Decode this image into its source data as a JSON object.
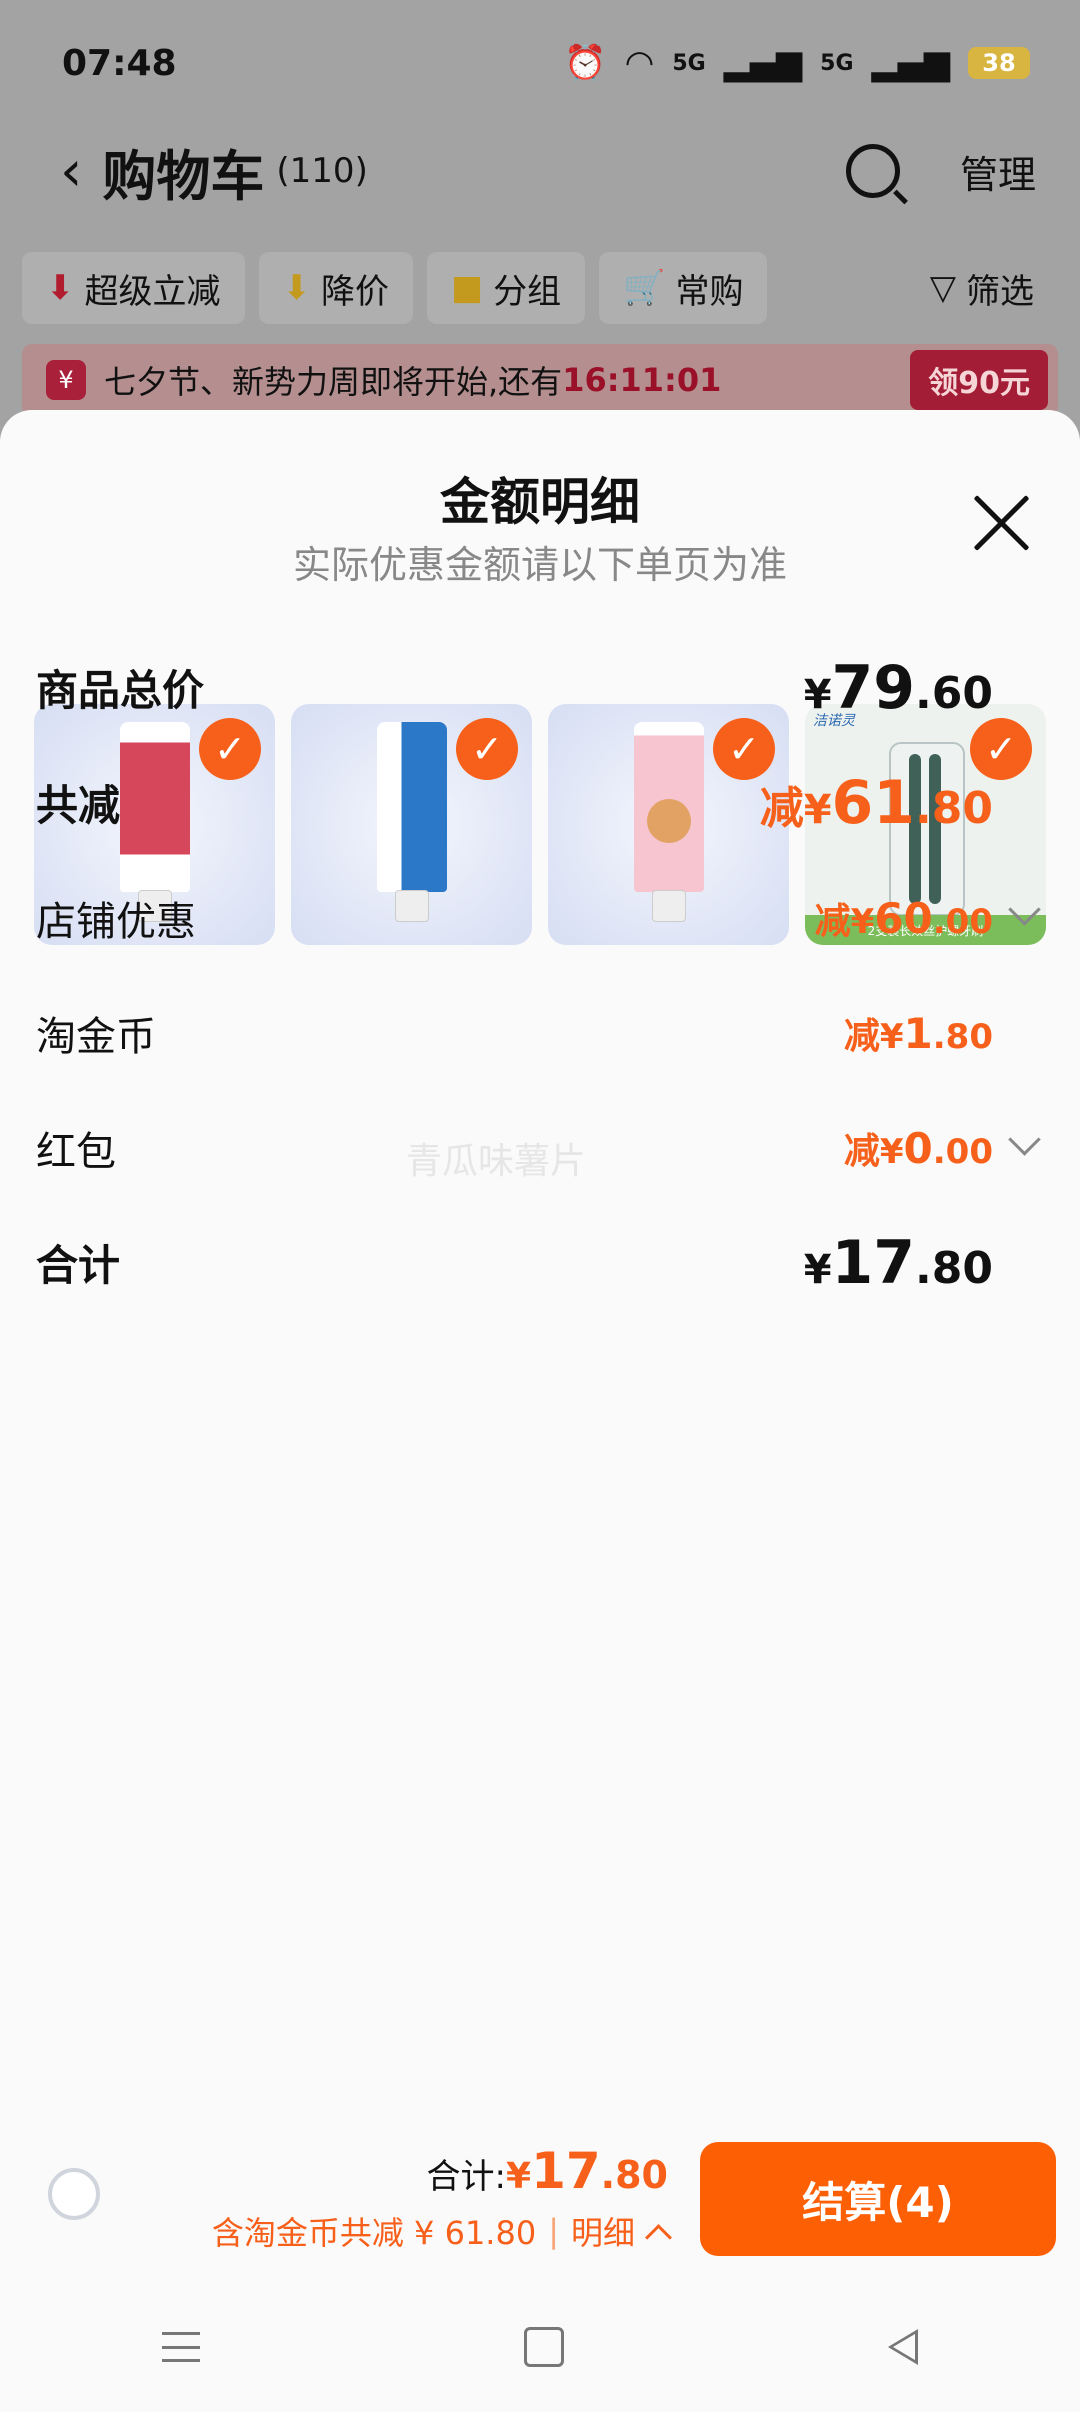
{
  "status_bar": {
    "time": "07:48",
    "battery": "38",
    "signal1": "5G",
    "signal2": "5G"
  },
  "cart_header": {
    "title": "购物车",
    "count": "(110)",
    "manage_label": "管理"
  },
  "filter_chips": [
    {
      "label": "超级立减",
      "icon": "arrow-down-red-icon"
    },
    {
      "label": "降价",
      "icon": "arrow-down-yellow-icon"
    },
    {
      "label": "分组",
      "icon": "folder-icon"
    },
    {
      "label": "常购",
      "icon": "cart-icon"
    }
  ],
  "filter_label": "筛选",
  "promo": {
    "text": "七夕节、新势力周即将开始,还有",
    "timer": "16:11:01",
    "coupon": "领90元"
  },
  "sheet": {
    "title": "金额明细",
    "subtitle": "实际优惠金额请以下单页为准",
    "products": [
      {
        "name": "toothpaste-red",
        "checked": true
      },
      {
        "name": "toothpaste-blue",
        "checked": true
      },
      {
        "name": "toothpaste-kids",
        "checked": true
      },
      {
        "name": "toothbrush-pack",
        "checked": true,
        "banner": "2支装长效丝护螺牙刷"
      }
    ],
    "brand_tag": "洁诺灵",
    "rows": {
      "total_price": {
        "label": "商品总价",
        "cur": "¥",
        "int": "79",
        "dec": ".60"
      },
      "total_discount": {
        "label": "共减",
        "prefix": "减",
        "cur": "¥",
        "int": "61",
        "dec": ".80"
      },
      "shop_discount": {
        "label": "店铺优惠",
        "prefix": "减",
        "cur": "¥",
        "int": "60",
        "dec": ".00"
      },
      "tao_coin": {
        "label": "淘金币",
        "prefix": "减",
        "cur": "¥",
        "int": "1",
        "dec": ".80"
      },
      "red_packet": {
        "label": "红包",
        "prefix": "减",
        "cur": "¥",
        "int": "0",
        "dec": ".00"
      },
      "grand_total": {
        "label": "合计",
        "cur": "¥",
        "int": "17",
        "dec": ".80"
      }
    },
    "watermark": "青瓜味薯片"
  },
  "bottom_bar": {
    "sum_label": "合计:",
    "sum_cur": "¥",
    "sum_int": "17",
    "sum_dec": ".80",
    "savings_text": "含淘金币共减 ¥ 61.80",
    "detail_label": "明细",
    "checkout_label": "结算(4)"
  },
  "colors": {
    "accent": "#f7601a",
    "checkout": "#fd6004",
    "promo_red": "#a41d37"
  }
}
